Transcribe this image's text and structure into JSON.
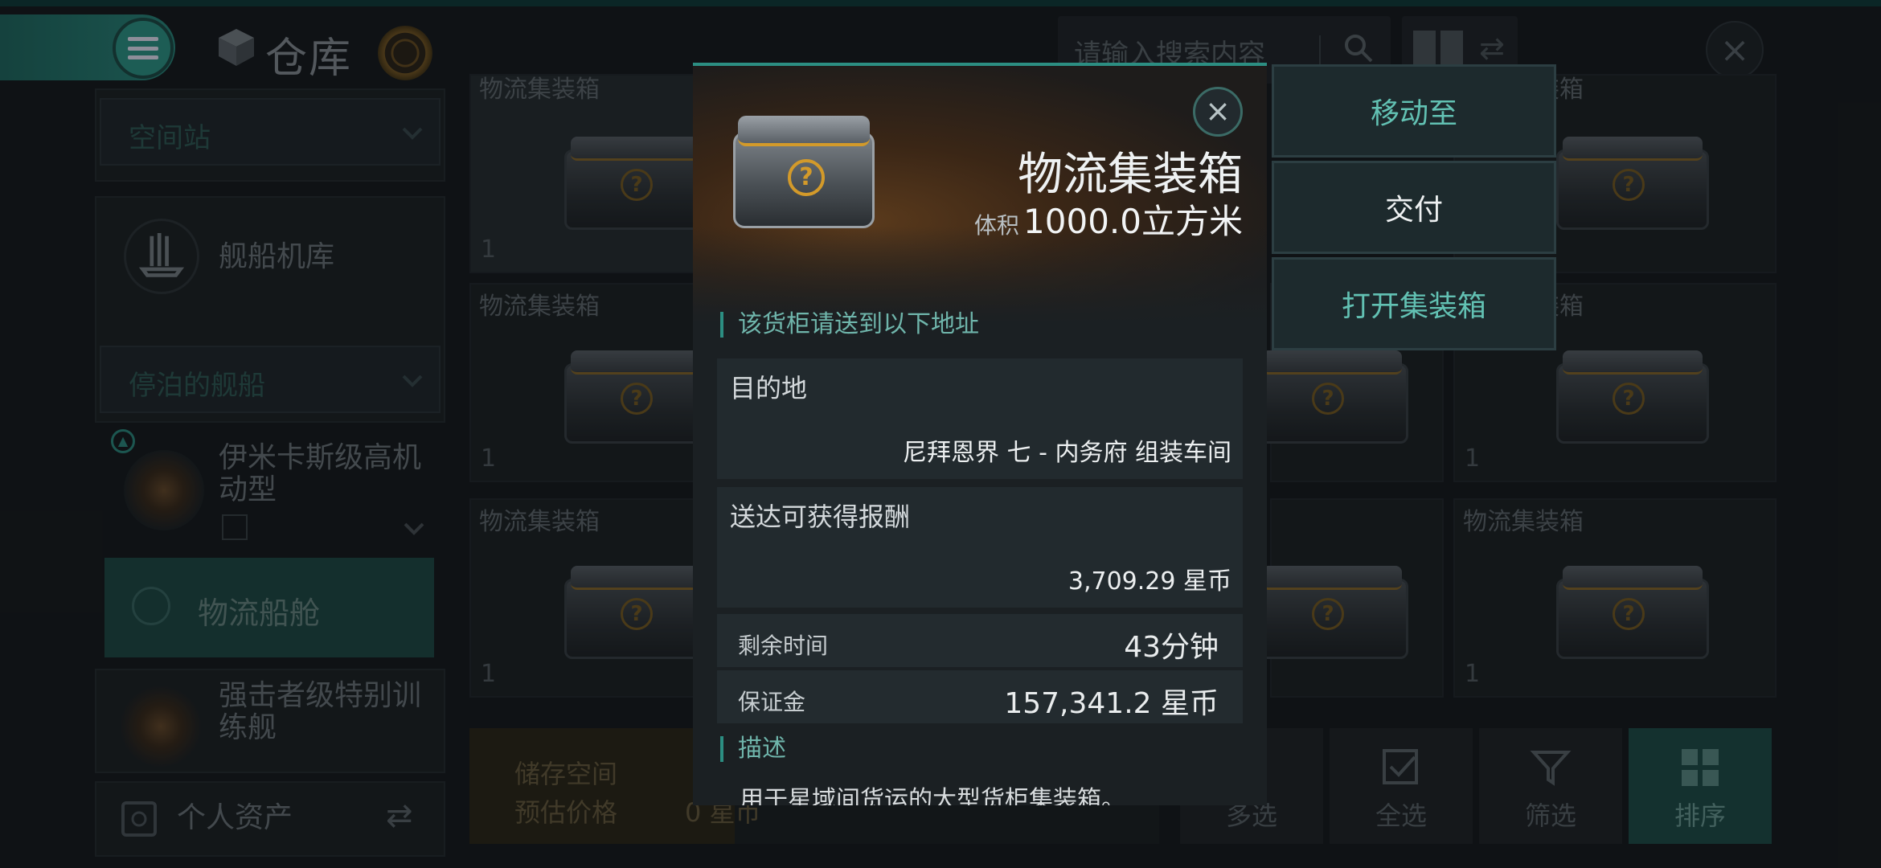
{
  "header": {
    "title": "仓库",
    "search_placeholder": "请输入搜索内容"
  },
  "sidebar": {
    "section_station": "空间站",
    "hangar_label": "舰船机库",
    "section_docked": "停泊的舰船",
    "docked_ship_1": "伊米卡斯级高机动型",
    "cargo_bay": "物流船舱",
    "docked_ship_2": "强击者级特别训练舰",
    "personal_assets": "个人资产"
  },
  "grid": {
    "item_name": "物流集装箱",
    "quantity": "1"
  },
  "bottom_bar": {
    "storage_label": "储存空间",
    "price_label": "预估价格",
    "price_value": "0 星币",
    "multi_select": "多选",
    "select_all": "全选",
    "filter": "筛选",
    "sort": "排序"
  },
  "popup": {
    "title": "物流集装箱",
    "volume_label": "体积",
    "volume_value": "1000.0立方米",
    "section_deliver": "该货柜请送到以下地址",
    "destination_label": "目的地",
    "destination_value": "尼拜恩界 七 - 内务府 组装车间",
    "reward_label": "送达可获得报酬",
    "reward_value": "3,709.29 星币",
    "time_label": "剩余时间",
    "time_value": "43分钟",
    "deposit_label": "保证金",
    "deposit_value": "157,341.2 星币",
    "section_desc": "描述",
    "description": "用于星域间货运的大型货柜集装箱。"
  },
  "actions": {
    "move_to": "移动至",
    "deliver": "交付",
    "open_container": "打开集装箱"
  },
  "colors": {
    "accent": "#2c8e82",
    "accent_text": "#62c1b3",
    "background": "#16191c"
  }
}
